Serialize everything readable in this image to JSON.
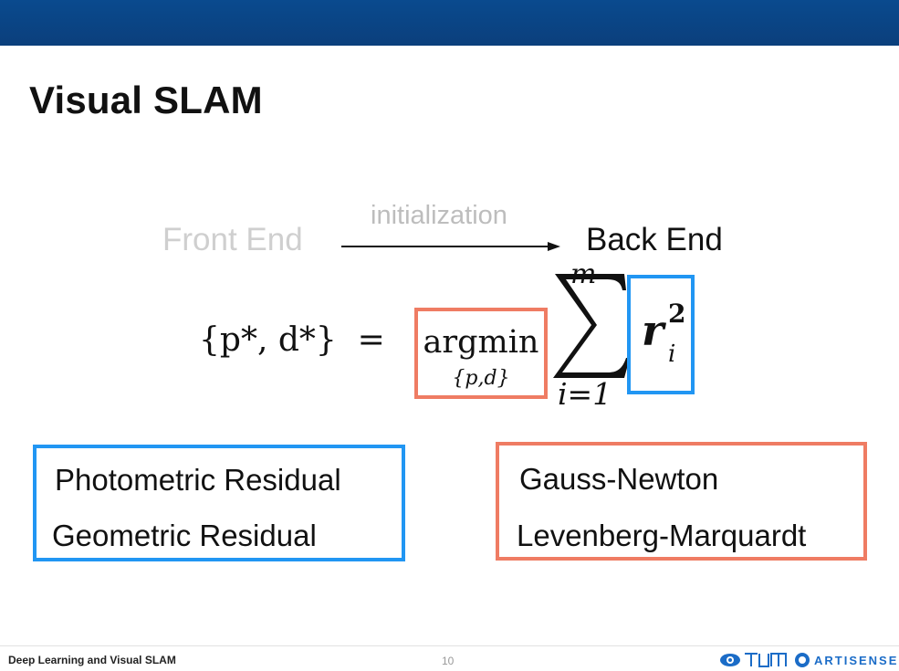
{
  "slide": {
    "title": "Visual SLAM",
    "page_number": "10",
    "footer_text": "Deep Learning and Visual SLAM",
    "header_bar_color": "#0b4585"
  },
  "pipeline": {
    "front_end": "Front End",
    "arrow_label": "initialization",
    "back_end": "Back End"
  },
  "equation": {
    "lhs": "{p*, d*}  =",
    "argmin": "argmin",
    "argmin_subscript": "{p,d}",
    "sum_upper": "m",
    "sum_lower": "i=1",
    "residual_base": "r",
    "residual_superscript": "2",
    "residual_subscript": "i"
  },
  "residuals_box": {
    "color": "#2196f3",
    "items": [
      "Photometric Residual",
      "Geometric Residual"
    ]
  },
  "optimizers_box": {
    "color": "#ef7c63",
    "items": [
      "Gauss-Newton",
      "Levenberg-Marquardt"
    ]
  },
  "logos": {
    "tum_logo": "TUM",
    "artisense_logo": "ARTISENSE"
  }
}
